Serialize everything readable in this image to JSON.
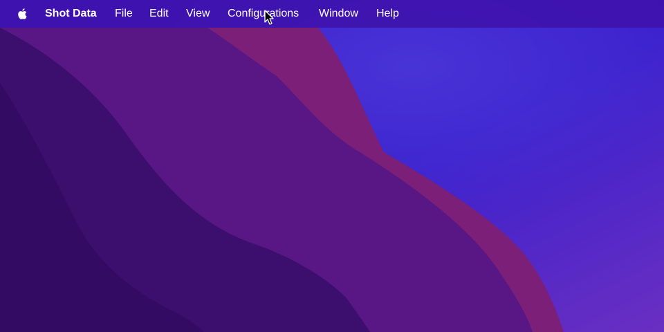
{
  "menubar": {
    "app_name": "Shot Data",
    "items": [
      "File",
      "Edit",
      "View",
      "Configurations",
      "Window",
      "Help"
    ]
  },
  "icons": {
    "system_menu": "apple-logo-icon",
    "pointer": "mouse-pointer-icon"
  },
  "colors": {
    "menubar_background": "#3e10a8",
    "menu_text": "#ffffff",
    "wallpaper_blue": "#3a1ed0",
    "wallpaper_magenta": "#7a1f78",
    "wallpaper_purple": "#561785",
    "wallpaper_dark": "#350d6a"
  }
}
